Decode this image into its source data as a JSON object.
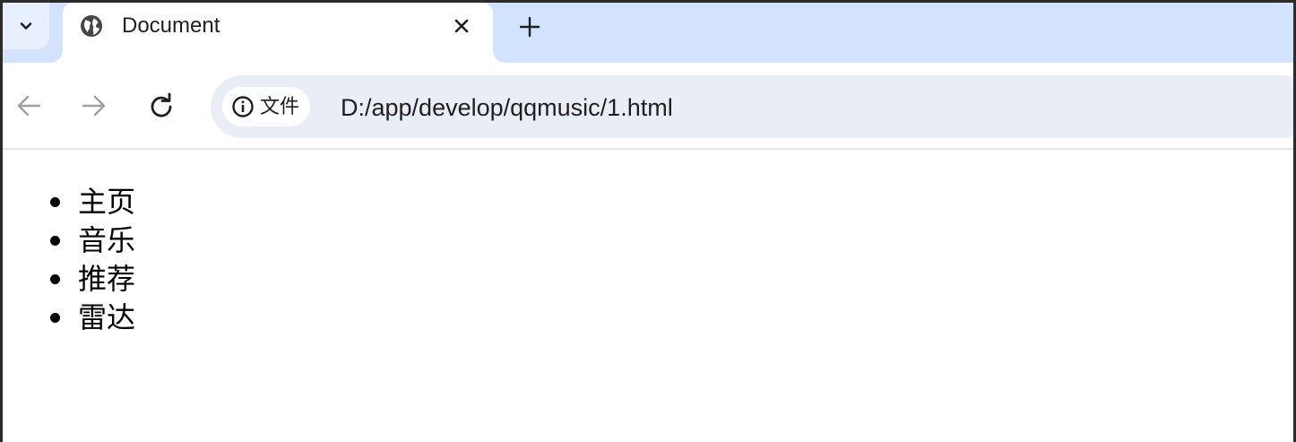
{
  "browser": {
    "tab": {
      "title": "Document"
    },
    "address_bar": {
      "chip_label": "文件",
      "url": "D:/app/develop/qqmusic/1.html"
    }
  },
  "page": {
    "list_items": [
      {
        "label": "主页"
      },
      {
        "label": "音乐"
      },
      {
        "label": "推荐"
      },
      {
        "label": "雷达"
      }
    ]
  },
  "icons": {
    "tab_search": "chevron-down-icon",
    "favicon": "globe-icon",
    "close": "close-icon",
    "new_tab": "plus-icon",
    "back": "arrow-left-icon",
    "forward": "arrow-right-icon",
    "reload": "reload-icon",
    "site_info": "info-icon"
  },
  "colors": {
    "tabstrip_bg": "#d3e3fd",
    "omnibox_bg": "#e9eef6",
    "text": "#1f1f1f"
  }
}
